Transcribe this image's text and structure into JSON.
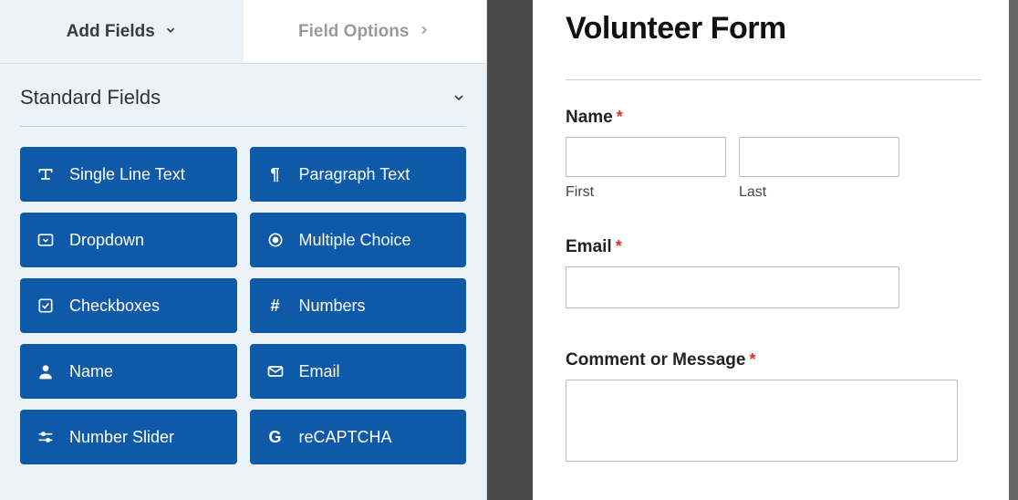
{
  "tabs": {
    "add_fields": "Add Fields",
    "field_options": "Field Options"
  },
  "section": {
    "title": "Standard Fields"
  },
  "fields": [
    {
      "icon": "text-type-icon",
      "label": "Single Line Text"
    },
    {
      "icon": "pilcrow-icon",
      "label": "Paragraph Text"
    },
    {
      "icon": "dropdown-icon",
      "label": "Dropdown"
    },
    {
      "icon": "radio-icon",
      "label": "Multiple Choice"
    },
    {
      "icon": "checkbox-icon",
      "label": "Checkboxes"
    },
    {
      "icon": "hash-icon",
      "label": "Numbers"
    },
    {
      "icon": "user-icon",
      "label": "Name"
    },
    {
      "icon": "envelope-icon",
      "label": "Email"
    },
    {
      "icon": "sliders-icon",
      "label": "Number Slider"
    },
    {
      "icon": "recaptcha-icon",
      "label": "reCAPTCHA"
    }
  ],
  "form": {
    "title": "Volunteer Form",
    "name_label": "Name",
    "first_sub": "First",
    "last_sub": "Last",
    "email_label": "Email",
    "comment_label": "Comment or Message",
    "required_mark": "*"
  },
  "colors": {
    "field_button_bg": "#0f5aa8",
    "panel_bg": "#ebf2f8",
    "required": "#d9342b"
  }
}
